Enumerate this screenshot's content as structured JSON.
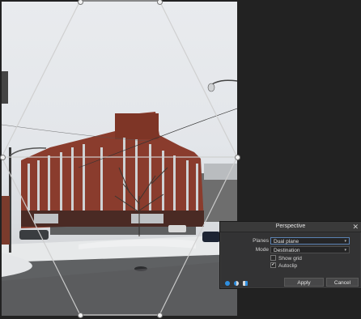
{
  "dialog": {
    "title": "Perspective",
    "planes_label": "Planes",
    "planes_value": "Dual plane",
    "mode_label": "Mode",
    "mode_value": "Destination",
    "show_grid_label": "Show grid",
    "show_grid_checked": false,
    "autoclip_label": "Autoclip",
    "autoclip_checked": true,
    "apply_label": "Apply",
    "cancel_label": "Cancel",
    "close_glyph": "✕",
    "dropdown_glyph": "▾",
    "check_glyph": "✔",
    "mode_icons": [
      "plane-blue-icon",
      "plane-half-icon",
      "plane-split-icon"
    ]
  },
  "colors": {
    "accent": "#2f8fe0",
    "brick": "#8a3c2d",
    "panel_bg": "#333334"
  }
}
